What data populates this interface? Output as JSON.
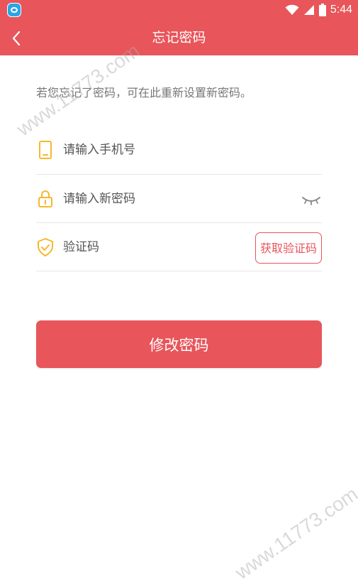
{
  "status_bar": {
    "time": "5:44"
  },
  "header": {
    "title": "忘记密码",
    "back_icon": "chevron-left-icon"
  },
  "hint": "若您忘记了密码，可在此重新设置新密码。",
  "form": {
    "phone": {
      "placeholder": "请输入手机号",
      "icon": "phone-icon"
    },
    "password": {
      "placeholder": "请输入新密码",
      "icon": "lock-icon",
      "toggle_icon": "eye-closed-icon"
    },
    "code": {
      "placeholder": "验证码",
      "icon": "shield-check-icon",
      "button_label": "获取验证码"
    }
  },
  "submit_label": "修改密码",
  "watermarks": [
    "www.11773.com",
    "www.11773.com"
  ],
  "colors": {
    "primary": "#e8555a",
    "icon_accent": "#f5b82e"
  }
}
